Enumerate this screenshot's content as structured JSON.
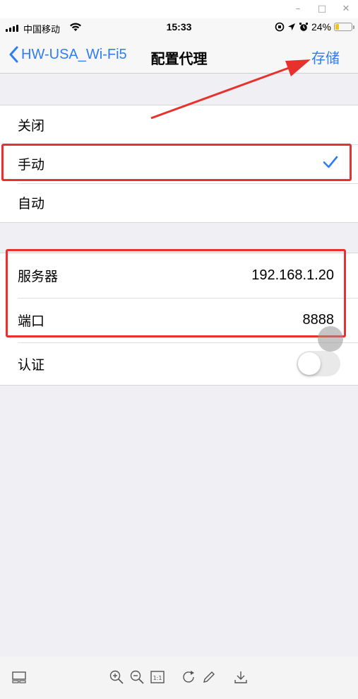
{
  "window": {
    "minimize": "–",
    "maximize": "□",
    "close": "✕"
  },
  "status_bar": {
    "carrier": "中国移动",
    "time": "15:33",
    "battery_percent": "24%",
    "battery_level": 0.24,
    "icons": [
      "signal-icon",
      "wifi-icon",
      "orientation-lock-icon",
      "location-icon",
      "alarm-icon",
      "battery-icon"
    ]
  },
  "nav": {
    "back_label": "HW-USA_Wi-Fi5",
    "title": "配置代理",
    "save_label": "存储"
  },
  "proxy_mode": {
    "options": [
      "关闭",
      "手动",
      "自动"
    ],
    "selected": "手动"
  },
  "manual_settings": {
    "server_label": "服务器",
    "server_value": "192.168.1.20",
    "port_label": "端口",
    "port_value": "8888",
    "auth_label": "认证",
    "auth_enabled": false
  },
  "annotation_color": "#e8312c",
  "accent_color": "#2f7cf6",
  "toolbar_icons": [
    "thumbnail-icon",
    "zoom-in-icon",
    "zoom-out-icon",
    "actual-size-icon",
    "rotate-icon",
    "edit-icon",
    "download-icon"
  ],
  "toolbar": {
    "actual_size_label": "1:1"
  }
}
